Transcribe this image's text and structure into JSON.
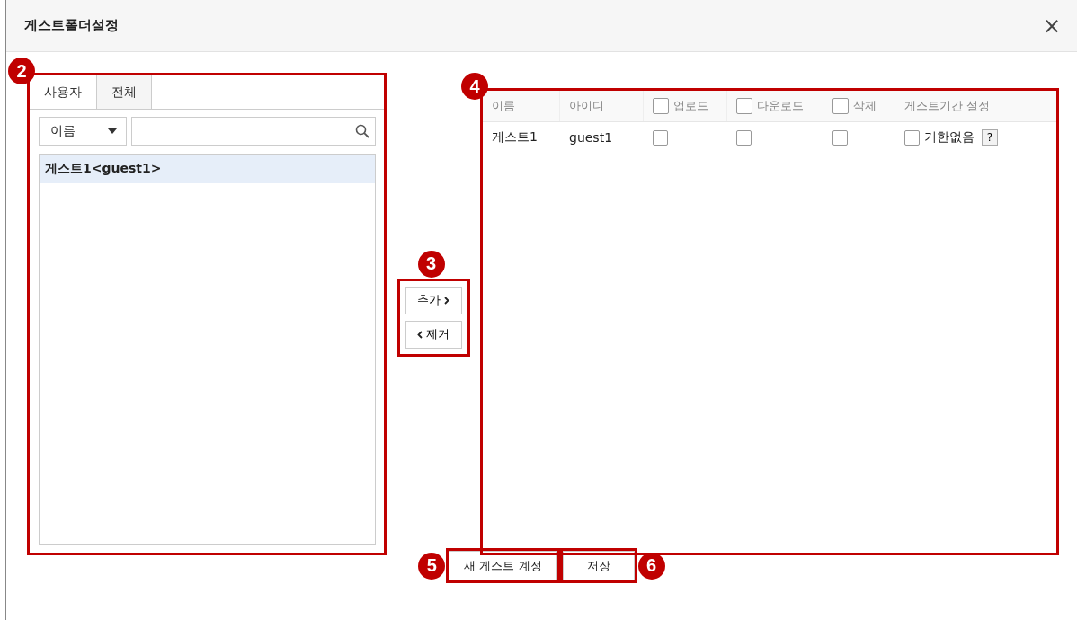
{
  "dialog": {
    "title": "게스트폴더설정",
    "close": "×"
  },
  "user_panel": {
    "callout": "2",
    "tabs": [
      {
        "label": "사용자",
        "selected": true
      },
      {
        "label": "전체",
        "selected": false
      }
    ],
    "search": {
      "field": "이름"
    },
    "users": [
      {
        "label": "게스트1<guest1>",
        "selected": true
      }
    ]
  },
  "transfer": {
    "callout": "3",
    "buttons": [
      {
        "label": "추가",
        "kind": "add"
      },
      {
        "label": "제거",
        "kind": "remove"
      }
    ]
  },
  "guest_table": {
    "callout": "4",
    "columns": [
      {
        "label": "이름",
        "kind": "text"
      },
      {
        "label": "아이디",
        "kind": "text"
      },
      {
        "label": "업로드",
        "kind": "check",
        "checked": false
      },
      {
        "label": "다운로드",
        "kind": "check",
        "checked": false
      },
      {
        "label": "삭제",
        "kind": "check",
        "checked": false
      },
      {
        "label": "게스트기간 설정",
        "kind": "text"
      }
    ],
    "rows": [
      {
        "name": "게스트1",
        "id": "guest1",
        "upload": false,
        "download": false,
        "delete": false,
        "no_limit": false,
        "no_limit_label": "기한없음",
        "help": "?"
      }
    ]
  },
  "footer": {
    "buttons": [
      {
        "label": "새 게스트 계정",
        "callout": "5"
      },
      {
        "label": "저장",
        "callout": "6"
      }
    ]
  }
}
